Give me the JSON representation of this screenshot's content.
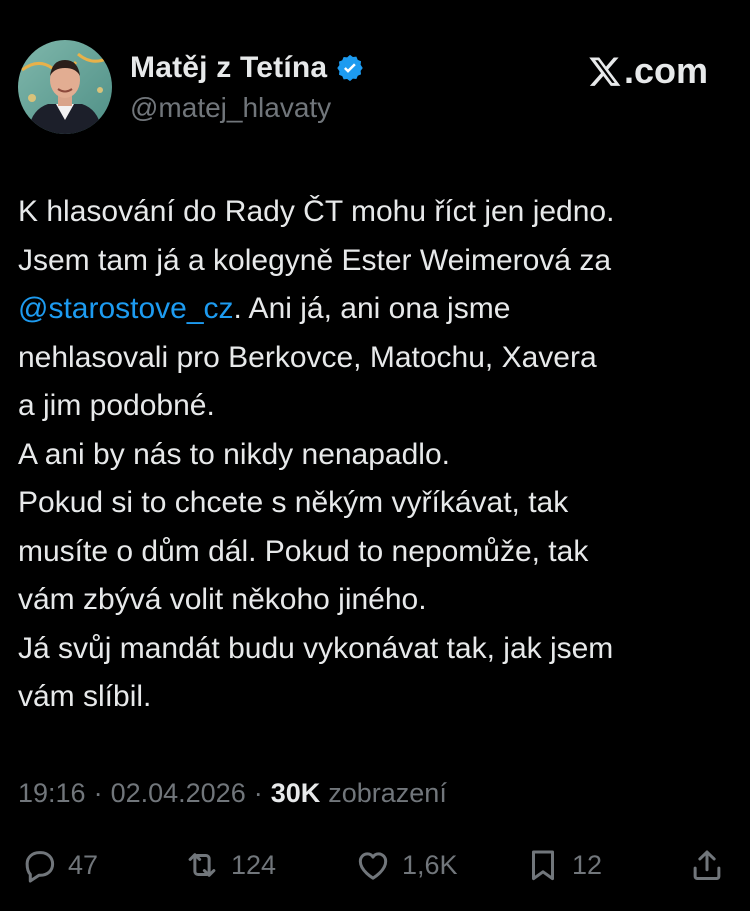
{
  "author": {
    "display_name": "Matěj z Tetína",
    "handle": "@matej_hlavaty",
    "verified": true
  },
  "brand": {
    "label": ".com",
    "icon": "x-logo-icon"
  },
  "tweet": {
    "lines": [
      {
        "segments": [
          {
            "text": "K hlasování do Rady ČT mohu říct jen jedno."
          }
        ]
      },
      {
        "segments": [
          {
            "text": "Jsem tam já a kolegyně Ester Weimerová za"
          }
        ]
      },
      {
        "segments": [
          {
            "text": "@starostove_cz",
            "mention": true
          },
          {
            "text": ". Ani já, ani ona jsme"
          }
        ]
      },
      {
        "segments": [
          {
            "text": "nehlasovali pro Berkovce, Matochu, Xavera"
          }
        ]
      },
      {
        "segments": [
          {
            "text": "a jim podobné."
          }
        ]
      },
      {
        "segments": [
          {
            "text": "A ani by nás to nikdy nenapadlo."
          }
        ]
      },
      {
        "segments": [
          {
            "text": "Pokud si to chcete s někým vyříkávat, tak"
          }
        ]
      },
      {
        "segments": [
          {
            "text": "musíte o dům dál. Pokud to nepomůže, tak"
          }
        ]
      },
      {
        "segments": [
          {
            "text": "vám zbývá volit někoho jiného."
          }
        ]
      },
      {
        "segments": [
          {
            "text": "Já svůj mandát budu vykonávat tak, jak jsem"
          }
        ]
      },
      {
        "segments": [
          {
            "text": "vám slíbil."
          }
        ]
      }
    ]
  },
  "meta": {
    "time": "19:16",
    "separator": "·",
    "date": "02.04.2026",
    "views_count": "30K",
    "views_label": "zobrazení"
  },
  "actions": {
    "replies": {
      "icon": "reply-icon",
      "count": "47"
    },
    "reposts": {
      "icon": "repost-icon",
      "count": "124"
    },
    "likes": {
      "icon": "heart-icon",
      "count": "1,6K"
    },
    "bookmarks": {
      "icon": "bookmark-icon",
      "count": "12"
    },
    "share": {
      "icon": "share-icon"
    }
  },
  "colors": {
    "background": "#000000",
    "text": "#e7e9ea",
    "muted": "#71767b",
    "accent": "#1d9bf0"
  }
}
